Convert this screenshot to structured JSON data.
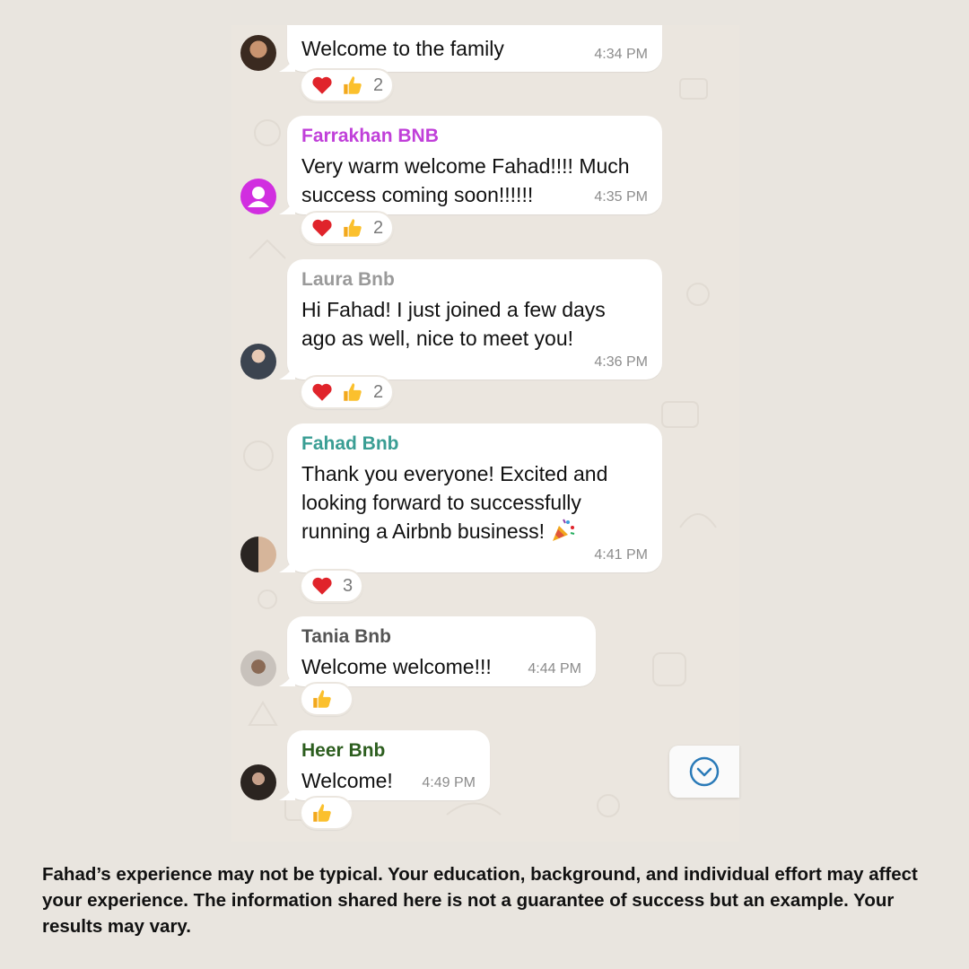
{
  "colors": {
    "page_bg": "#e9e5df",
    "chat_bg": "#ebe6df",
    "bubble_bg": "#ffffff",
    "time_text": "#8c8c8c",
    "scroll_icon": "#2a7ab8"
  },
  "messages": [
    {
      "sender": "",
      "sender_color": "",
      "text": "Welcome to the family",
      "time": "4:34 PM",
      "avatar_icon": "profile-photo-icon",
      "reactions": {
        "icons": [
          "heart-icon",
          "thumbs-up-icon"
        ],
        "count": "2"
      }
    },
    {
      "sender": "Farrakhan BNB",
      "sender_color": "#c03fd9",
      "text": "Very warm welcome Fahad!!!! Much\nsuccess coming soon!!!!!!",
      "time": "4:35 PM",
      "avatar_icon": "default-user-icon",
      "reactions": {
        "icons": [
          "heart-icon",
          "thumbs-up-icon"
        ],
        "count": "2"
      }
    },
    {
      "sender": "Laura Bnb",
      "sender_color": "#9a9a9a",
      "text": "Hi Fahad! I just joined a few days\nago as well, nice to meet you!",
      "time": "4:36 PM",
      "avatar_icon": "profile-photo-icon",
      "reactions": {
        "icons": [
          "heart-icon",
          "thumbs-up-icon"
        ],
        "count": "2"
      }
    },
    {
      "sender": "Fahad Bnb",
      "sender_color": "#3a9e94",
      "text": "Thank you everyone! Excited and\nlooking forward to successfully\nrunning a Airbnb business!",
      "text_icon": "party-popper-icon",
      "time": "4:41 PM",
      "avatar_icon": "profile-photo-icon",
      "reactions": {
        "icons": [
          "heart-icon"
        ],
        "count": "3"
      }
    },
    {
      "sender": "Tania Bnb",
      "sender_color": "#555555",
      "text": "Welcome welcome!!!",
      "time": "4:44 PM",
      "avatar_icon": "profile-photo-icon",
      "reactions": {
        "icons": [
          "thumbs-up-icon"
        ],
        "count": ""
      }
    },
    {
      "sender": "Heer Bnb",
      "sender_color": "#2d5e1f",
      "text": "Welcome!",
      "time": "4:49 PM",
      "avatar_icon": "profile-photo-icon",
      "reactions": {
        "icons": [
          "thumbs-up-icon"
        ],
        "count": ""
      }
    }
  ],
  "scroll_button": {
    "icon": "chevron-down-circle-icon"
  },
  "disclaimer": "Fahad’s experience may not be typical. Your education, background, and individual effort may affect your experience. The information shared here is not a guarantee of success but an example. Your results may vary."
}
